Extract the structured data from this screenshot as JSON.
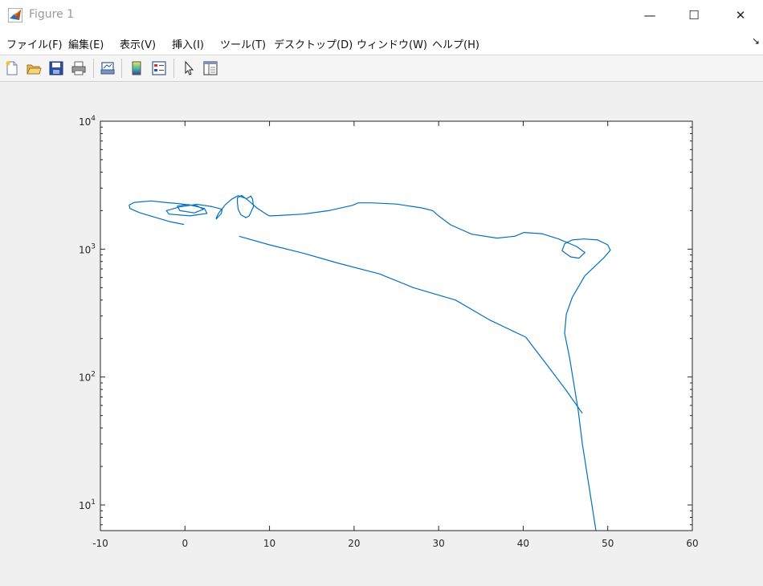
{
  "window": {
    "title": "Figure 1",
    "minimize_glyph": "—",
    "maximize_glyph": "☐",
    "close_glyph": "✕"
  },
  "menu": {
    "items": [
      "ファイル(F)",
      "編集(E)",
      "表示(V)",
      "挿入(I)",
      "ツール(T)",
      "デスクトップ(D)",
      "ウィンドウ(W)",
      "ヘルプ(H)"
    ],
    "dock_glyph": "↘"
  },
  "toolbar": {
    "icons": [
      "new-figure-icon",
      "open-file-icon",
      "save-icon",
      "print-icon",
      "link-plot-icon",
      "colorbar-icon",
      "legend-icon",
      "pointer-icon",
      "property-editor-icon"
    ]
  },
  "colors": {
    "line": "#0072BD",
    "axes": "#262626",
    "background": "#f0f0f0",
    "plot_background": "#ffffff"
  },
  "chart_data": {
    "type": "line",
    "title": "",
    "xlabel": "",
    "ylabel": "",
    "xlim": [
      -10,
      60
    ],
    "ylim": [
      6.3,
      10000
    ],
    "yscale": "log",
    "xticks": [
      -10,
      0,
      10,
      20,
      30,
      40,
      50,
      60
    ],
    "yticks": [
      10,
      100,
      1000,
      10000
    ],
    "ytick_labels": [
      {
        "base": "10",
        "exp": "1"
      },
      {
        "base": "10",
        "exp": "2"
      },
      {
        "base": "10",
        "exp": "3"
      },
      {
        "base": "10",
        "exp": "4"
      }
    ],
    "grid": false,
    "series": [
      {
        "x": [
          48.6,
          47.0,
          46.5,
          45.5,
          44.9,
          45.1,
          45.8,
          47.3,
          49.5,
          50.3,
          50.0,
          48.8,
          47.2,
          45.8,
          44.9,
          44.6,
          45.6,
          46.6,
          47.3,
          46.3,
          44.2,
          42.2,
          40.1,
          39.0,
          36.9,
          33.9,
          31.4,
          30.0,
          29.3,
          28.0,
          25.0,
          22.0,
          20.5,
          19.8,
          17.0,
          14.0,
          11.0,
          10.0,
          9.7,
          8.5,
          7.5,
          6.7,
          6.2,
          6.2,
          6.3,
          6.6,
          7.2,
          7.6,
          8.1,
          8.0,
          7.8,
          7.3,
          6.3,
          5.5,
          4.8,
          4.0,
          3.7,
          3.7,
          4.3,
          4.4,
          3.2,
          1.4,
          -0.6,
          -2.2,
          -1.9,
          0.6,
          2.6,
          2.3,
          0.4,
          -0.9,
          -0.6,
          1.1,
          2.2,
          1.4,
          -0.8,
          -2.4,
          -4.0,
          -6.0,
          -6.6,
          -6.5,
          -5.4,
          -3.5,
          -1.8,
          -0.1
        ],
        "y": [
          6.3,
          30,
          55,
          140,
          220,
          310,
          420,
          620,
          850,
          980,
          1080,
          1180,
          1200,
          1180,
          1100,
          970,
          870,
          850,
          940,
          1050,
          1200,
          1320,
          1350,
          1260,
          1220,
          1310,
          1550,
          1820,
          2000,
          2100,
          2250,
          2300,
          2300,
          2200,
          2000,
          1880,
          1830,
          1820,
          1860,
          2100,
          2400,
          2630,
          2520,
          2300,
          2050,
          1860,
          1760,
          1820,
          2150,
          2450,
          2600,
          2480,
          2620,
          2450,
          2230,
          1920,
          1750,
          1720,
          1900,
          2050,
          2150,
          2240,
          2140,
          2000,
          1880,
          1820,
          1900,
          2080,
          2230,
          2170,
          2000,
          1920,
          2050,
          2180,
          2270,
          2320,
          2380,
          2320,
          2210,
          2080,
          1930,
          1770,
          1640,
          1560
        ]
      },
      {
        "x": [
          6.4,
          10.0,
          14.0,
          18.0,
          23.0,
          27.0,
          32.0,
          36.0,
          40.3,
          43.0,
          45.0,
          47.0
        ],
        "y": [
          1260,
          1080,
          930,
          780,
          640,
          500,
          400,
          280,
          205,
          120,
          80,
          52
        ]
      }
    ]
  }
}
